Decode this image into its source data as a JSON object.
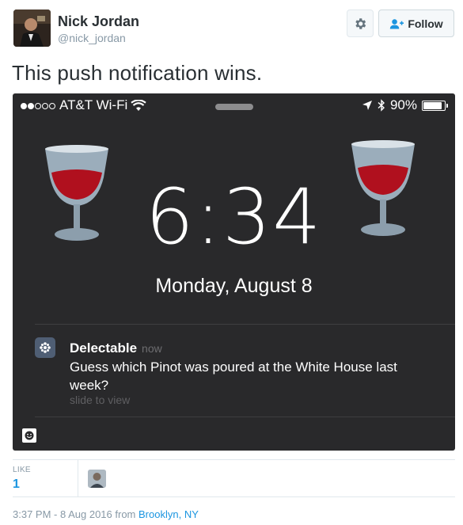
{
  "author": {
    "name": "Nick Jordan",
    "handle": "@nick_jordan"
  },
  "actions": {
    "follow_label": "Follow"
  },
  "tweet": {
    "text": "This push notification wins."
  },
  "phone": {
    "carrier": "AT&T Wi-Fi",
    "battery": "90%",
    "battery_level": 0.9,
    "time": "6:34",
    "date": "Monday, August 8",
    "notification": {
      "app": "Delectable",
      "time": "now",
      "body": "Guess which Pinot was poured at the White House last week?",
      "hint": "slide to view"
    }
  },
  "stats": {
    "like_label": "LIKE",
    "like_count": "1"
  },
  "meta": {
    "timestamp": "3:37 PM - 8 Aug 2016",
    "from_word": "from",
    "place": "Brooklyn, NY"
  },
  "colors": {
    "link": "#1b95e0",
    "wine": "#b0101e",
    "glass": "#8fa0ac"
  }
}
